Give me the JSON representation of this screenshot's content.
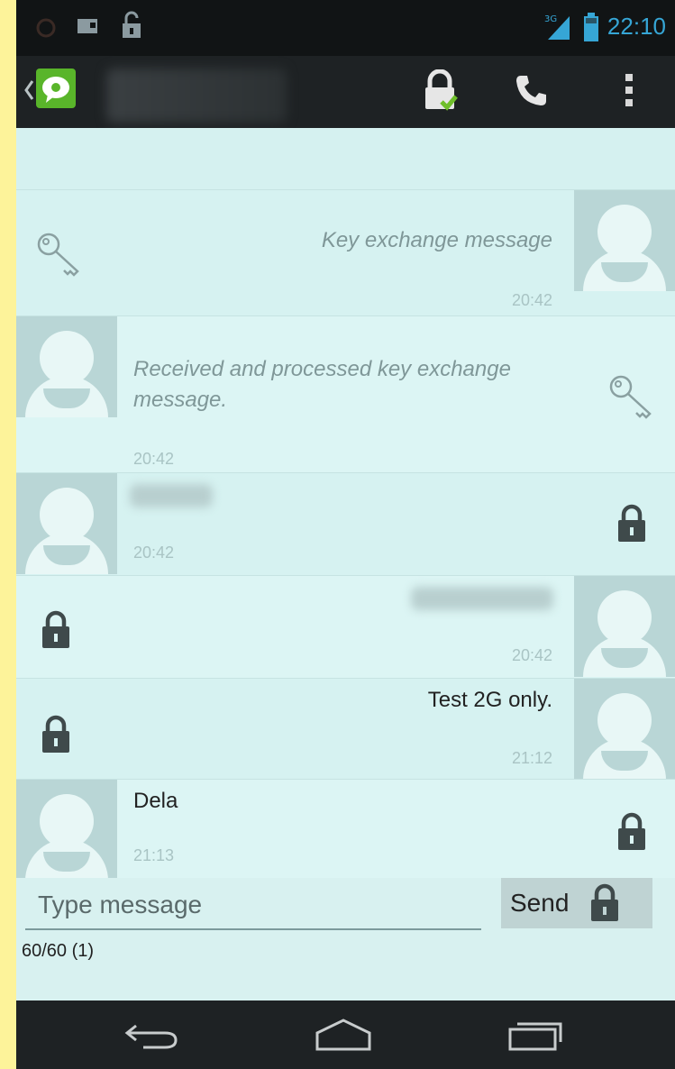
{
  "status_bar": {
    "time": "22:10",
    "network": "3G",
    "icons": [
      "notification-icon",
      "sim-card-icon",
      "unlock-icon",
      "signal-icon",
      "battery-icon"
    ]
  },
  "action_bar": {
    "icons": [
      "app-icon",
      "secure-lock-icon",
      "phone-icon",
      "overflow-menu-icon"
    ]
  },
  "messages": [
    {
      "side": "outgoing",
      "text": "Key exchange message",
      "time": "20:42",
      "italic": true,
      "icon": "key-icon"
    },
    {
      "side": "incoming",
      "text": "Received and processed key exchange message.",
      "time": "20:42",
      "italic": true,
      "icon": "key-icon"
    },
    {
      "side": "incoming",
      "text": "",
      "time": "20:42",
      "icon": "lock-icon"
    },
    {
      "side": "outgoing",
      "text": "",
      "time": "20:42",
      "icon": "lock-icon"
    },
    {
      "side": "outgoing",
      "text": "Test 2G only.",
      "time": "21:12",
      "icon": "lock-icon"
    },
    {
      "side": "incoming",
      "text": "Dela",
      "time": "21:13",
      "icon": "lock-icon"
    }
  ],
  "compose": {
    "placeholder": "Type message",
    "send_label": "Send",
    "counter": "60/60 (1)"
  },
  "colors": {
    "accent": "#36a6d6",
    "app_green": "#59b52a",
    "conversation_bg": "#d7f3f2"
  }
}
